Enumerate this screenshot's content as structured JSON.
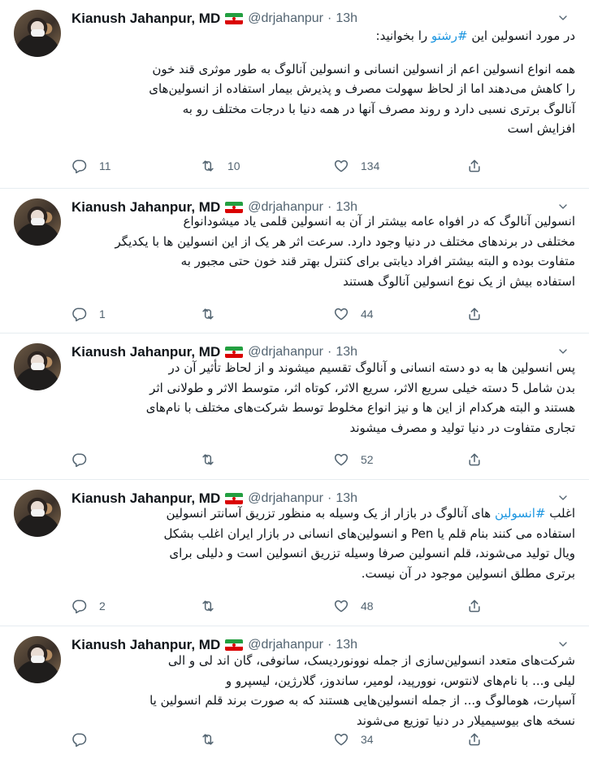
{
  "colors": {
    "accent": "#1b95e0",
    "secondary_text": "#536471",
    "divider": "#e6ecf0"
  },
  "icons": {
    "reply": "reply-icon",
    "retweet": "retweet-icon",
    "like": "heart-icon",
    "share": "share-icon",
    "more": "chevron-down-icon",
    "flag": "iran-flag-icon"
  },
  "tweets": [
    {
      "name": "Kianush Jahanpur, MD",
      "handle": "@drjahanpur",
      "dot": "·",
      "time": "13h",
      "lines": [
        {
          "pre": "در مورد انسولین این ",
          "hashtag": "#رشتو",
          "post": " را بخوانید:"
        },
        {
          "gap": true
        },
        {
          "text": "همه انواع انسولین اعم از انسولین  انسانی و انسولین آنالوگ به طور موثری قند خون"
        },
        {
          "text": "را کاهش می‌دهند اما از لحاظ سهولت مصرف و پذیرش بیمار استفاده از انسولین‌های"
        },
        {
          "text": "آنالوگ برتری نسبی دارد و روند مصرف آنها در همه دنیا با درجات مختلف رو به"
        },
        {
          "text": "افزایش است"
        }
      ],
      "replies": "11",
      "retweets": "10",
      "likes": "134"
    },
    {
      "name": "Kianush Jahanpur, MD",
      "handle": "@drjahanpur",
      "dot": "·",
      "time": "13h",
      "lines": [
        {
          "text": "انسولین آنالوگ که در افواه عامه بیشتر از آن به انسولین قلمی یاد میشودانواع"
        },
        {
          "text": "مختلفی در برندهای مختلف در دنیا وجود دارد. سرعت اثر هر یک از این انسولین ها با یکدیگر"
        },
        {
          "text": "متفاوت بوده و البته بیشتر افراد دیابتی برای کنترل بهتر قند خون حتی مجبور به"
        },
        {
          "text": "استفاده بیش از یک نوع انسولین آنالوگ هستند"
        }
      ],
      "replies": "1",
      "retweets": "",
      "likes": "44"
    },
    {
      "name": "Kianush Jahanpur, MD",
      "handle": "@drjahanpur",
      "dot": "·",
      "time": "13h",
      "lines": [
        {
          "text": "پس انسولین ها به دو دسته انسانی و آنالوگ تقسیم میشوند و از لحاظ تأثیر آن در"
        },
        {
          "text": "بدن شامل 5 دسته خیلی سریع الاثر، سریع الاثر، کوتاه اثر، متوسط الاثر و طولانی اثر"
        },
        {
          "text": "هستند و البته هرکدام از این ها و نیز انواع مخلوط توسط شرکت‌های مختلف با نام‌های"
        },
        {
          "text": "تجاری متفاوت در دنیا تولید و مصرف میشوند"
        }
      ],
      "replies": "",
      "retweets": "",
      "likes": "52"
    },
    {
      "name": "Kianush Jahanpur, MD",
      "handle": "@drjahanpur",
      "dot": "·",
      "time": "13h",
      "lines": [
        {
          "pre": "اغلب ",
          "hashtag": "#انسولین",
          "post": " های آنالوگ در بازار از یک وسیله به منظور تزریق آسانتر انسولین"
        },
        {
          "text": "استفاده می کنند بنام قلم یا Pen و انسولین‌های انسانی در بازار ایران اغلب بشکل"
        },
        {
          "text": "ویال تولید می‌شوند، قلم انسولین صرفا وسیله تزریق انسولین است و دلیلی برای"
        },
        {
          "text": "برتری مطلق انسولین موجود در آن نیست."
        }
      ],
      "replies": "2",
      "retweets": "",
      "likes": "48"
    },
    {
      "name": "Kianush Jahanpur, MD",
      "handle": "@drjahanpur",
      "dot": "·",
      "time": "13h",
      "lines": [
        {
          "text": "شرکت‌های متعدد انسولین‌سازی از جمله نوونوردیسک، سانوفی، گان اند لی و الی"
        },
        {
          "text": "لیلی و... با نام‌های  لانتوس، نوورپید، لومیر، ساندوز، گلارژین، لیسپرو و"
        },
        {
          "text": "آسپارت، هومالوگ و... از جمله انسولین‌هایی هستند که به صورت برند قلم انسولین یا"
        },
        {
          "text": "نسخه های بیوسیمیلار در دنیا توزیع می‌شوند"
        }
      ],
      "replies": "",
      "retweets": "",
      "likes": "34"
    }
  ]
}
